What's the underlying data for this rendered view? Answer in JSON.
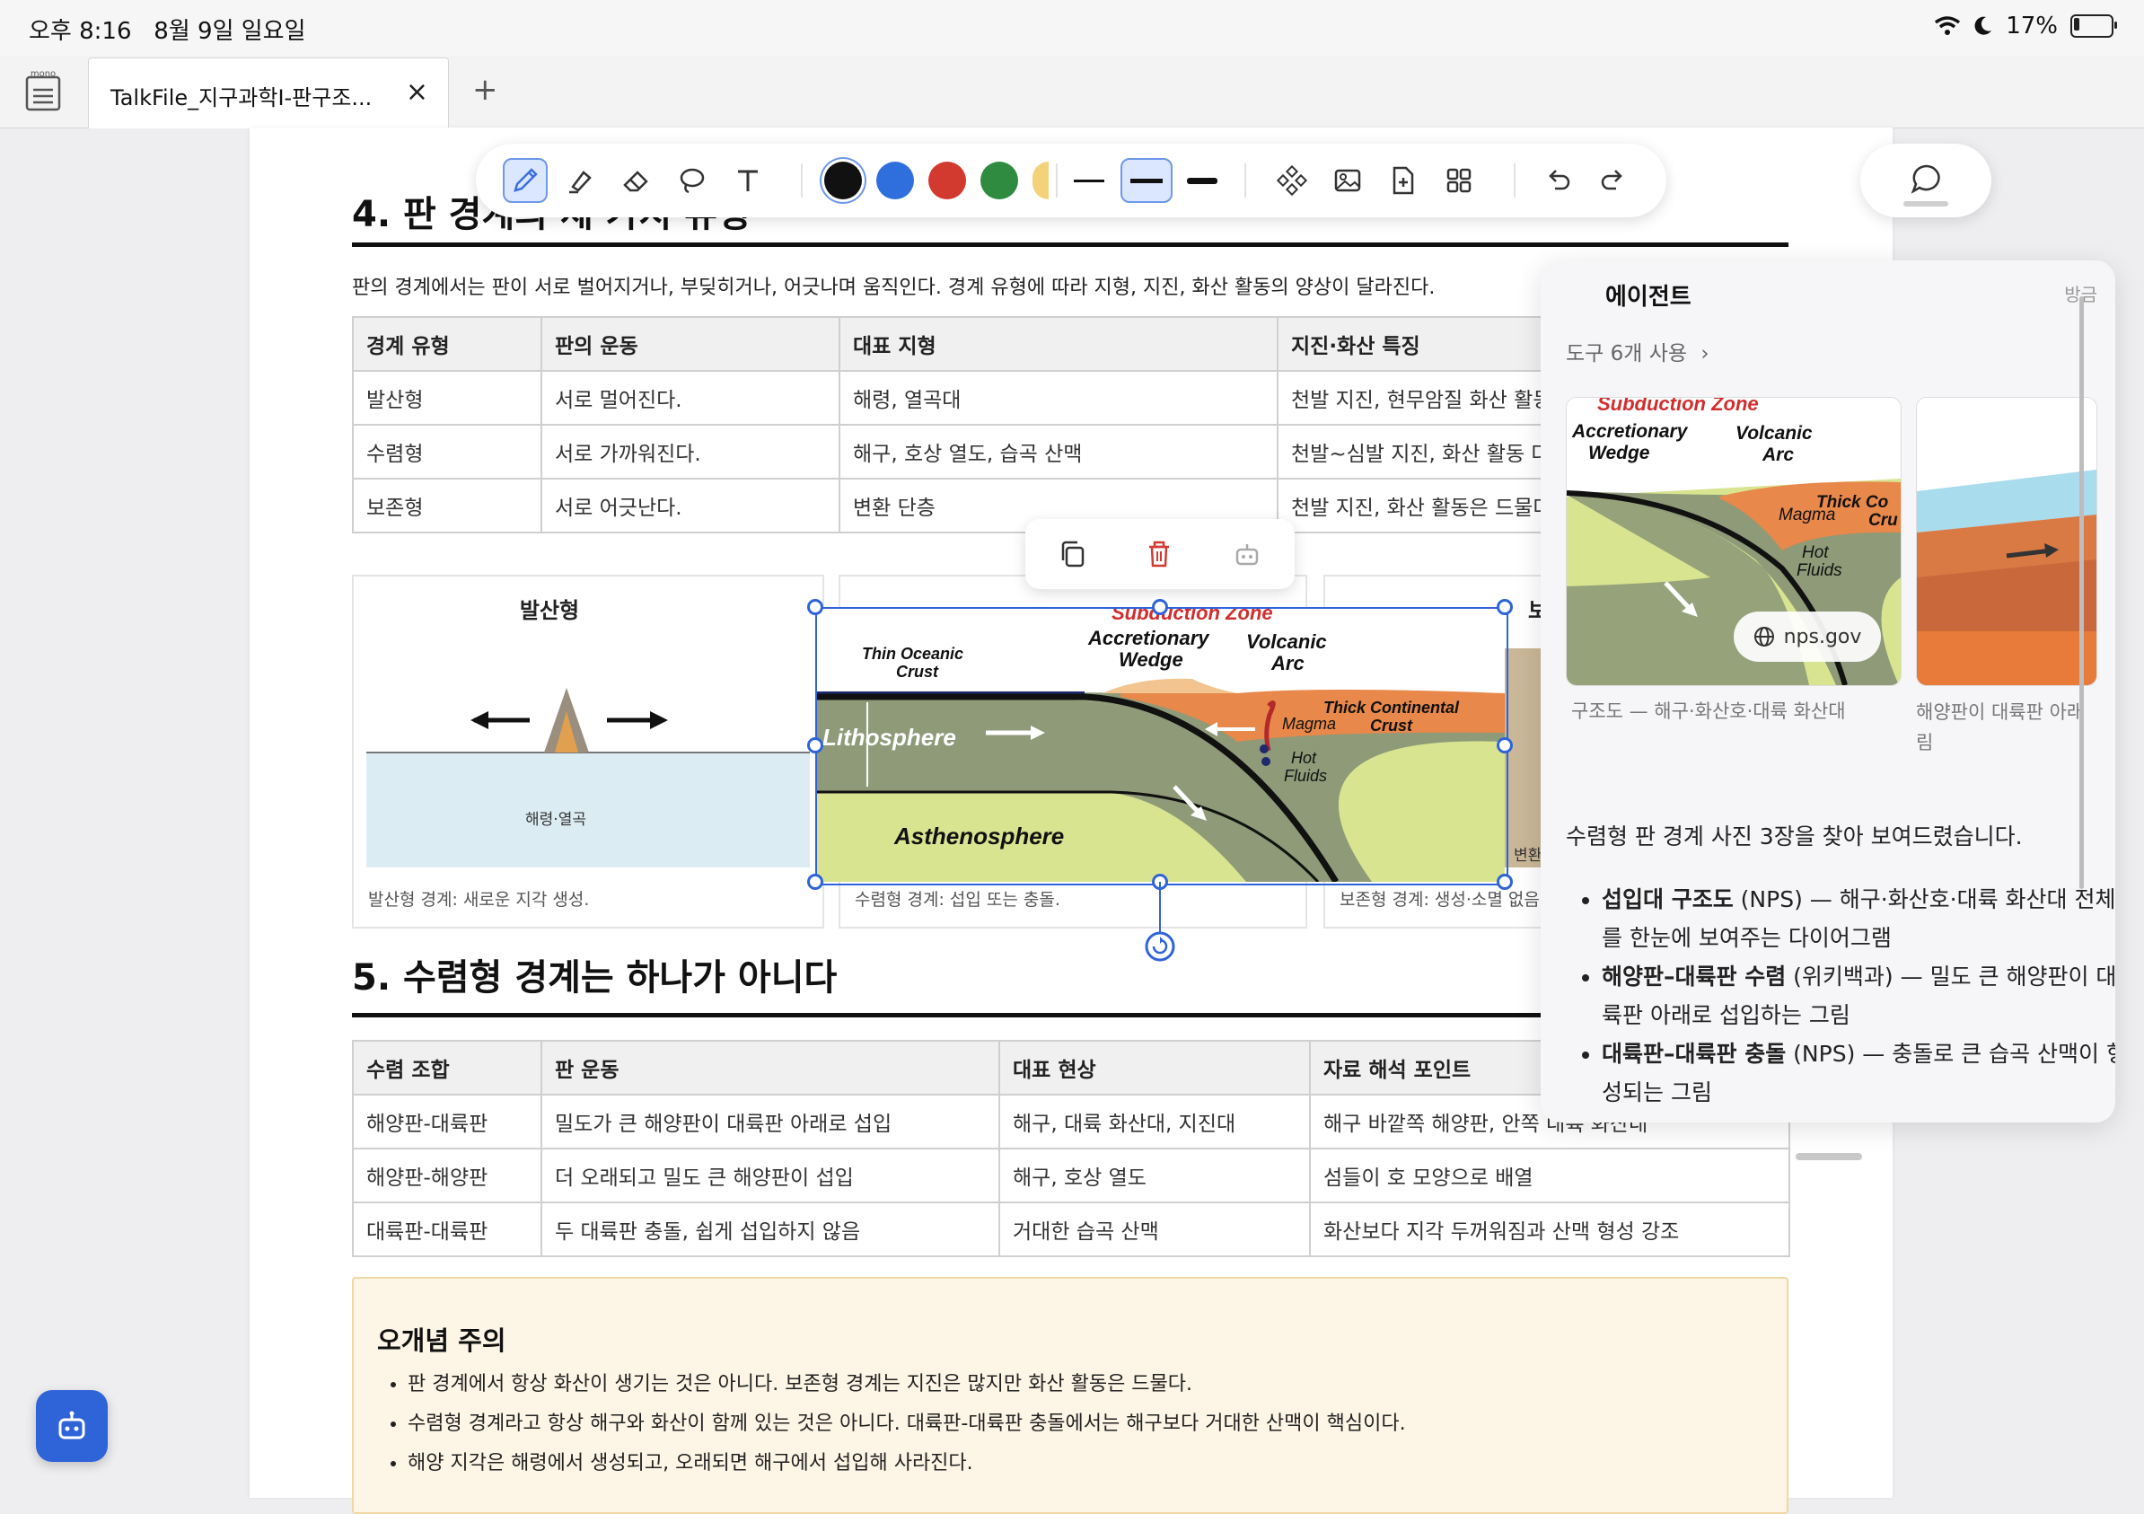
{
  "status_bar": {
    "time": "오후 8:16",
    "date": "8월 9일 일요일",
    "battery": "17%",
    "battery_level": 0.17
  },
  "tabs": {
    "app_logo_text": "mono",
    "active_title": "TalkFile_지구과학I-판구조...",
    "close": "×",
    "new_tab": "+"
  },
  "toolbar": {
    "colors": [
      "#111111",
      "#2f6fdd",
      "#d23a2f",
      "#2e8b40",
      "#f3d27a"
    ],
    "active_tool": "pen"
  },
  "document": {
    "section4_title": "4. 판 경계의 세 가지 유형",
    "section4_intro": "판의 경계에서는 판이 서로 벌어지거나, 부딪히거나, 어긋나며 움직인다. 경계 유형에 따라 지형, 지진, 화산 활동의 양상이 달라진다.",
    "table1": {
      "headers": [
        "경계 유형",
        "판의 운동",
        "대표 지형",
        "지진·화산 특징"
      ],
      "rows": [
        [
          "발산형",
          "서로 멀어진다.",
          "해령, 열곡대",
          "천발 지진, 현무암질 화산 활동"
        ],
        [
          "수렴형",
          "서로 가까워진다.",
          "해구, 호상 열도, 습곡 산맥",
          "천발~심발 지진, 화산 활동 다양"
        ],
        [
          "보존형",
          "서로 어긋난다.",
          "변환 단층",
          "천발 지진, 화산 활동은 드물다"
        ]
      ]
    },
    "figures": {
      "divergent_title": "발산형",
      "divergent_label": "해령·열곡",
      "divergent_caption": "발산형 경계: 새로운 지각 생성.",
      "convergent_caption": "수렴형 경계: 섭입 또는 충돌.",
      "transform_title": "보존형",
      "transform_label": "변환 단층",
      "transform_caption": "보존형 경계: 생성·소멸 없음"
    },
    "subduction_diagram": {
      "title": "Subduction Zone",
      "accretionary": "Accretionary",
      "wedge": "Wedge",
      "volcanic": "Volcanic",
      "arc": "Arc",
      "thin_oceanic": "Thin Oceanic",
      "crust": "Crust",
      "thick_continental": "Thick Continental",
      "crust2": "Crust",
      "lithosphere": "Lithosphere",
      "asthenosphere": "Asthenosphere",
      "magma": "Magma",
      "hot": "Hot",
      "fluids": "Fluids"
    },
    "section5_title": "5. 수렴형 경계는 하나가 아니다",
    "table2": {
      "headers": [
        "수렴 조합",
        "판 운동",
        "대표 현상",
        "자료 해석 포인트"
      ],
      "rows": [
        [
          "해양판-대륙판",
          "밀도가 큰 해양판이 대륙판 아래로 섭입",
          "해구, 대륙 화산대, 지진대",
          "해구 바깥쪽 해양판, 안쪽 대륙 화산대"
        ],
        [
          "해양판-해양판",
          "더 오래되고 밀도 큰 해양판이 섭입",
          "해구, 호상 열도",
          "섬들이 호 모양으로 배열"
        ],
        [
          "대륙판-대륙판",
          "두 대륙판 충돌, 쉽게 섭입하지 않음",
          "거대한 습곡 산맥",
          "화산보다 지각 두꺼워짐과 산맥 형성 강조"
        ]
      ]
    },
    "callout": {
      "title": "오개념 주의",
      "items": [
        "판 경계에서 항상 화산이 생기는 것은 아니다. 보존형 경계는 지진은 많지만 화산 활동은 드물다.",
        "수렴형 경계라고 항상 해구와 화산이 함께 있는 것은 아니다. 대륙판-대륙판 충돌에서는 해구보다 거대한 산맥이 핵심이다.",
        "해양 지각은 해령에서 생성되고, 오래되면 해구에서 섭입해 사라진다."
      ]
    }
  },
  "agent_panel": {
    "title": "에이전트",
    "dismiss": "방금",
    "tools_used": "도구 6개 사용",
    "card1_source": "nps.gov",
    "card1_caption": "구조도 — 해구·화산호·대륙 화산대",
    "card2_caption_line1": "해양판이 대륙판 아래",
    "card2_caption_line2": "림",
    "thick_con": "Thick Co",
    "cru": "Cru",
    "summary": "수렴형 판 경계 사진 3장을 찾아 보여드렸습니다.",
    "items": [
      {
        "bold": "섭입대 구조도",
        "rest": " (NPS) — 해구·화산호·대륙 화산대 전체를 한눈에 보여주는 다이어그램"
      },
      {
        "bold": "해양판–대륙판 수렴",
        "rest": " (위키백과) — 밀도 큰 해양판이 대륙판 아래로 섭입하는 그림"
      },
      {
        "bold": "대륙판–대륙판 충돌",
        "rest": " (NPS) — 충돌로 큰 습곡 산맥이 형성되는 그림"
      }
    ]
  }
}
